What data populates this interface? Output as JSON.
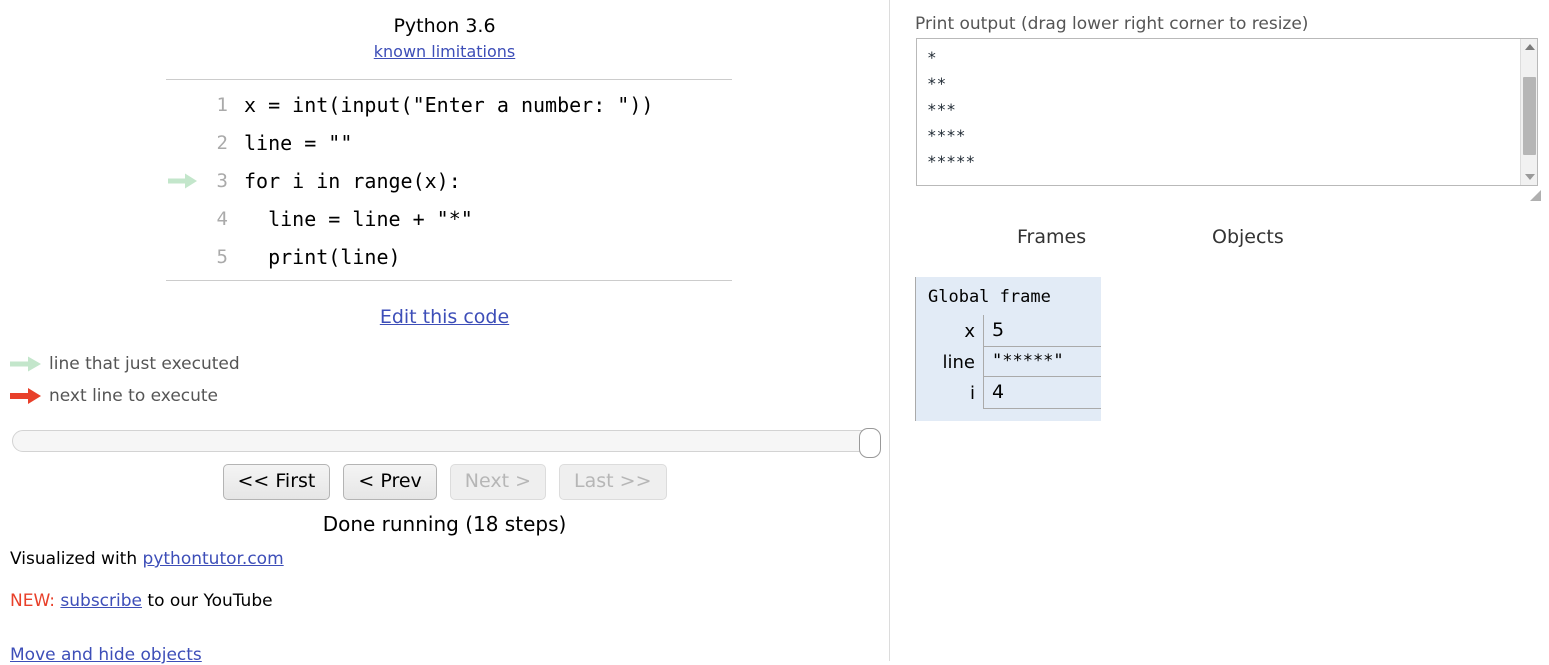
{
  "language": {
    "title": "Python 3.6",
    "limitations_link": "known limitations"
  },
  "code": {
    "lines": [
      {
        "number": "1",
        "text": "x = int(input(\"Enter a number: \"))",
        "arrow": "none"
      },
      {
        "number": "2",
        "text": "line = \"\"",
        "arrow": "none"
      },
      {
        "number": "3",
        "text": "for i in range(x):",
        "arrow": "green"
      },
      {
        "number": "4",
        "text": "  line = line + \"*\"",
        "arrow": "none"
      },
      {
        "number": "5",
        "text": "  print(line)",
        "arrow": "none"
      }
    ],
    "edit_link": "Edit this code"
  },
  "legend": {
    "just_executed": "line that just executed",
    "next_line": "next line to execute",
    "green_color": "#c3e6cb",
    "red_color": "#e8402a"
  },
  "controls": {
    "first_label": "<< First",
    "prev_label": "< Prev",
    "next_label": "Next >",
    "last_label": "Last >>",
    "status": "Done running (18 steps)"
  },
  "footer": {
    "visualized_prefix": "Visualized with ",
    "site_link": "pythontutor.com",
    "new_tag": "NEW:",
    "subscribe_link": "subscribe",
    "subscribe_suffix": " to our YouTube",
    "move_hide_link": "Move and hide objects"
  },
  "output": {
    "label": "Print output (drag lower right corner to resize)",
    "text": "*\n**\n***\n****\n*****"
  },
  "visualization": {
    "frames_header": "Frames",
    "objects_header": "Objects",
    "frame_title": "Global frame",
    "frame_bg": "#e2ebf6",
    "variables": [
      {
        "name": "x",
        "value": "5"
      },
      {
        "name": "line",
        "value": "\"*****\""
      },
      {
        "name": "i",
        "value": "4"
      }
    ]
  }
}
